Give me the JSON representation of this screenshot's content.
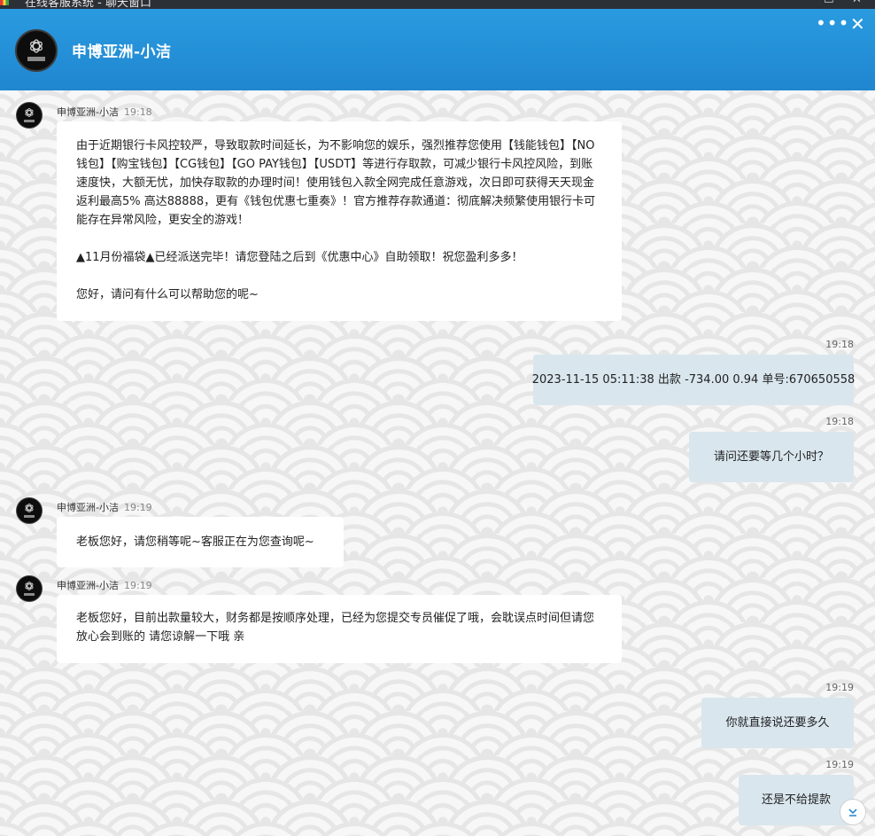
{
  "window": {
    "title": "在线客服系统 - 聊天窗口",
    "min_glyph": "☐",
    "close_glyph": "✕",
    "app_icon": "multicolor-app-icon"
  },
  "header": {
    "agent_name": "申博亚洲-小洁",
    "avatar_icon": "flower-logo-icon",
    "more_glyph": "•••",
    "close_glyph": "✕"
  },
  "messages": {
    "m1": {
      "sender": "申博亚洲-小洁",
      "time": "19:18",
      "paragraphs": [
        "由于近期银行卡风控较严，导致取款时间延长，为不影响您的娱乐，强烈推荐您使用【钱能钱包】【NO钱包】【购宝钱包】【CG钱包】【GO PAY钱包】【USDT】等进行存取款，可减少银行卡风控风险，到账速度快，大额无忧，加快存取款的办理时间！使用钱包入款全网完成任意游戏，次日即可获得天天现金返利最高5% 高达88888，更有《钱包优惠七重奏》！官方推荐存款通道：彻底解决频繁使用银行卡可能存在异常风险，更安全的游戏！",
        "▲11月份福袋▲已经派送完毕！请您登陆之后到《优惠中心》自助领取！祝您盈利多多！",
        "您好，请问有什么可以帮助您的呢~"
      ]
    },
    "m2": {
      "time": "19:18",
      "text": "2023-11-15 05:11:38 出款 -734.00 0.94 单号:670650558"
    },
    "m3": {
      "time": "19:18",
      "text": "请问还要等几个小时？"
    },
    "m4": {
      "sender": "申博亚洲-小洁",
      "time": "19:19",
      "text": "老板您好，请您稍等呢~客服正在为您查询呢~"
    },
    "m5": {
      "sender": "申博亚洲-小洁",
      "time": "19:19",
      "text": "老板您好，目前出款量较大，财务都是按顺序处理，已经为您提交专员催促了哦，会耽误点时间但请您放心会到账的 请您谅解一下哦 亲"
    },
    "m6": {
      "time": "19:19",
      "text": "你就直接说还要多久"
    },
    "m7": {
      "time": "19:19",
      "text": "还是不给提款"
    }
  },
  "scroll_down_glyph": "⌄",
  "colors": {
    "header_blue": "#1f86cf",
    "outgoing_bubble": "#d9e6ee",
    "incoming_bubble": "#ffffff"
  }
}
